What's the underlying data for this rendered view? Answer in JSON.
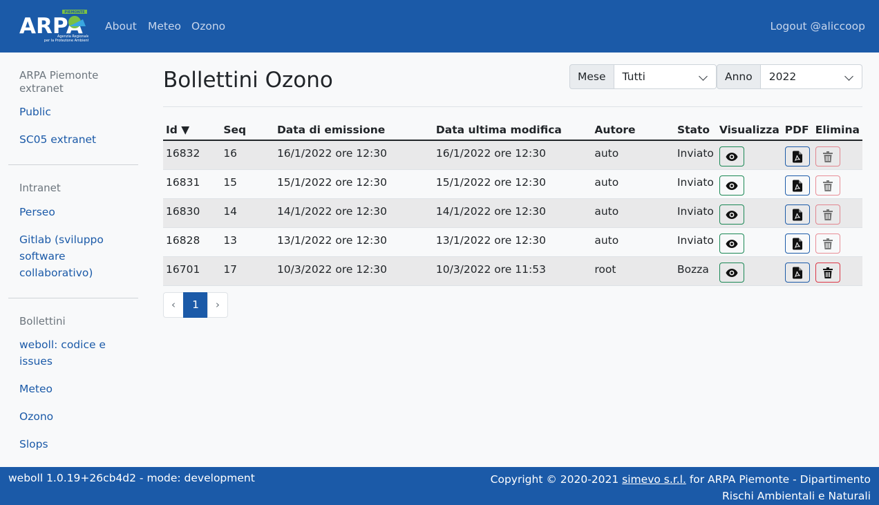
{
  "navbar": {
    "logo_text": "ARPA PIEMONTE Agenzia Regionale per la Protezione Ambientale",
    "links": [
      "About",
      "Meteo",
      "Ozono"
    ],
    "logout": "Logout @aliccoop"
  },
  "sidebar": {
    "sections": [
      {
        "heading": "ARPA Piemonte extranet",
        "items": [
          "Public",
          "SC05 extranet"
        ]
      },
      {
        "heading": "Intranet",
        "items": [
          "Perseo",
          "Gitlab (sviluppo software collaborativo)"
        ]
      },
      {
        "heading": "Bollettini",
        "items": [
          "weboll: codice e issues",
          "Meteo",
          "Ozono",
          "Slops"
        ]
      }
    ]
  },
  "main": {
    "title": "Bollettini Ozono",
    "filters": {
      "mese_label": "Mese",
      "mese_value": "Tutti",
      "anno_label": "Anno",
      "anno_value": "2022"
    },
    "table": {
      "headers": [
        "Id ▼",
        "Seq",
        "Data di emissione",
        "Data ultima modifica",
        "Autore",
        "Stato",
        "Visualizza",
        "PDF",
        "Elimina"
      ],
      "rows": [
        {
          "id": "16832",
          "seq": "16",
          "emissione": "16/1/2022 ore 12:30",
          "modifica": "16/1/2022 ore 12:30",
          "autore": "auto",
          "stato": "Inviato",
          "delete_enabled": false
        },
        {
          "id": "16831",
          "seq": "15",
          "emissione": "15/1/2022 ore 12:30",
          "modifica": "15/1/2022 ore 12:30",
          "autore": "auto",
          "stato": "Inviato",
          "delete_enabled": false
        },
        {
          "id": "16830",
          "seq": "14",
          "emissione": "14/1/2022 ore 12:30",
          "modifica": "14/1/2022 ore 12:30",
          "autore": "auto",
          "stato": "Inviato",
          "delete_enabled": false
        },
        {
          "id": "16828",
          "seq": "13",
          "emissione": "13/1/2022 ore 12:30",
          "modifica": "13/1/2022 ore 12:30",
          "autore": "auto",
          "stato": "Inviato",
          "delete_enabled": false
        },
        {
          "id": "16701",
          "seq": "17",
          "emissione": "10/3/2022 ore 12:30",
          "modifica": "10/3/2022 ore 11:53",
          "autore": "root",
          "stato": "Bozza",
          "delete_enabled": true
        }
      ]
    },
    "pagination": {
      "prev": "‹",
      "current": "1",
      "next": "›"
    }
  },
  "footer": {
    "left": "weboll 1.0.19+26cb4d2 - mode: development",
    "copyright_prefix": "Copyright © 2020-2021 ",
    "company_link": "simevo s.r.l.",
    "copyright_suffix": " for ARPA Piemonte - Dipartimento Rischi Ambientali e Naturali"
  },
  "colors": {
    "primary": "#1b5aa8",
    "success": "#198754",
    "danger": "#dc3545"
  }
}
